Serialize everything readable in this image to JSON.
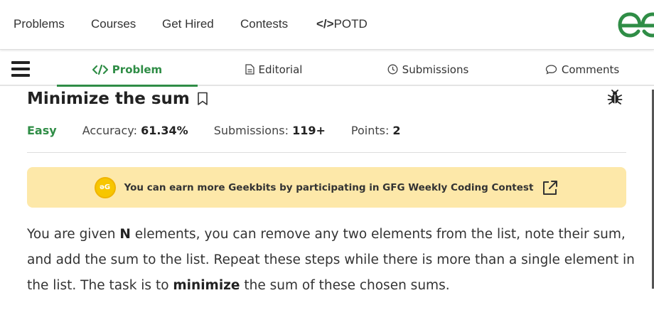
{
  "topnav": {
    "items": [
      "Problems",
      "Courses",
      "Get Hired",
      "Contests"
    ],
    "potd_code": "</>",
    "potd_label": "POTD"
  },
  "tabs": [
    {
      "label": "Problem",
      "icon": "code-icon",
      "active": true
    },
    {
      "label": "Editorial",
      "icon": "document-icon",
      "active": false
    },
    {
      "label": "Submissions",
      "icon": "clock-icon",
      "active": false
    },
    {
      "label": "Comments",
      "icon": "chat-icon",
      "active": false
    }
  ],
  "problem": {
    "title": "Minimize the sum",
    "difficulty": "Easy",
    "accuracy_label": "Accuracy:",
    "accuracy_value": "61.34%",
    "submissions_label": "Submissions:",
    "submissions_value": "119+",
    "points_label": "Points:",
    "points_value": "2"
  },
  "banner": {
    "coin_text": "əG",
    "text": "You can earn more Geekbits by participating in GFG Weekly Coding Contest"
  },
  "description": {
    "p1": "You are given ",
    "b1": "N",
    "p2": " elements, you can remove any two elements from the list, note their sum, and add the sum to the list. Repeat these steps while there is more than a single element in the list. The task is to ",
    "b2": "minimize",
    "p3": " the sum of these chosen sums."
  },
  "colors": {
    "brand_green": "#2f8d46",
    "banner_bg": "#fde8a9",
    "coin": "#f7c600"
  }
}
